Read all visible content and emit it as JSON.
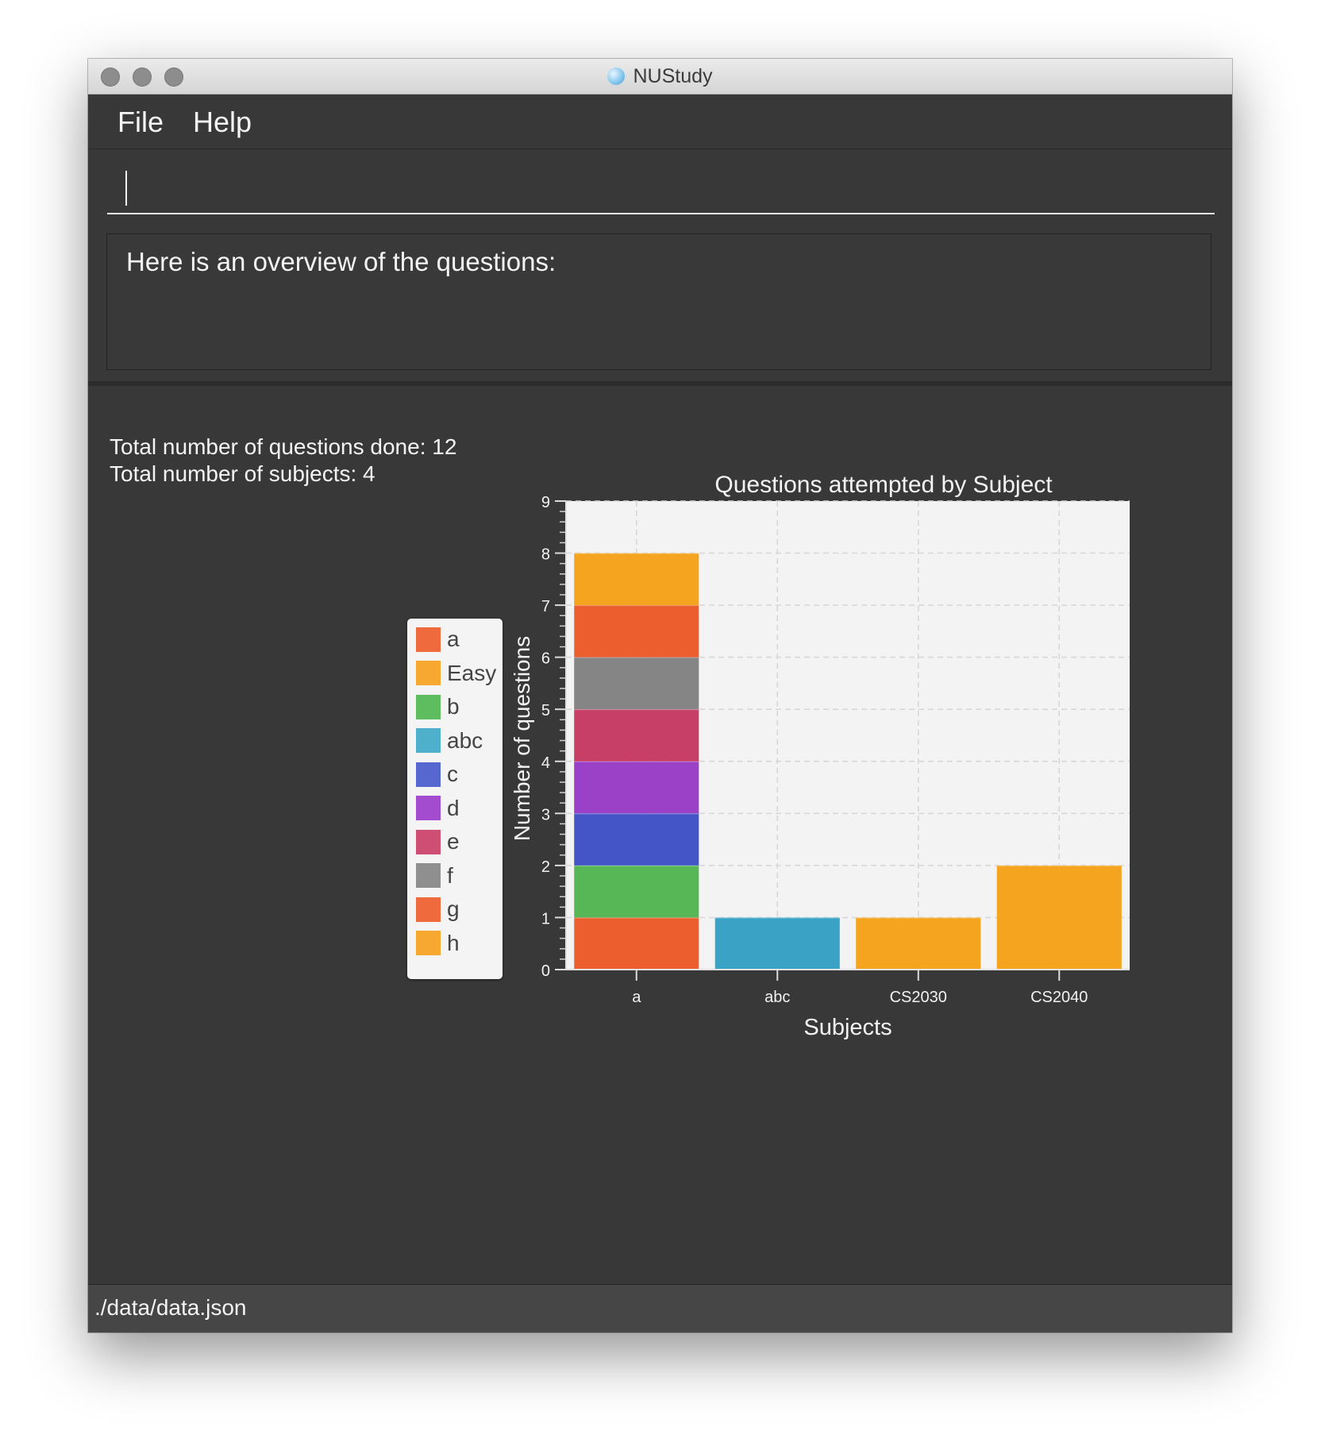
{
  "window": {
    "title": "NUStudy"
  },
  "menu": {
    "file": "File",
    "help": "Help"
  },
  "command": {
    "value": ""
  },
  "result": {
    "message": "Here is an overview of the questions:"
  },
  "stats": {
    "questions_done": "Total number of questions done: 12",
    "subjects": "Total number of subjects: 4"
  },
  "legend": [
    {
      "label": "a",
      "color": "#ef6a3c"
    },
    {
      "label": "Easy",
      "color": "#f6a830"
    },
    {
      "label": "b",
      "color": "#5ebd5e"
    },
    {
      "label": "abc",
      "color": "#4fb0cc"
    },
    {
      "label": "c",
      "color": "#5767d0"
    },
    {
      "label": "d",
      "color": "#a44ccf"
    },
    {
      "label": "e",
      "color": "#cf4f74"
    },
    {
      "label": "f",
      "color": "#8f8f8f"
    },
    {
      "label": "g",
      "color": "#ef6a3c"
    },
    {
      "label": "h",
      "color": "#f6a830"
    }
  ],
  "chart_data": {
    "type": "bar",
    "stacked": true,
    "title": "Questions attempted by Subject",
    "xlabel": "Subjects",
    "ylabel": "Number of questions",
    "ylim": [
      0,
      9
    ],
    "y_ticks": [
      "0",
      "1",
      "2",
      "3",
      "4",
      "5",
      "6",
      "7",
      "8",
      "9"
    ],
    "grid": true,
    "legend_position": "left",
    "categories": [
      "a",
      "abc",
      "CS2030",
      "CS2040"
    ],
    "series": [
      {
        "name": "a",
        "color": "#ec5e2d",
        "values": [
          1,
          0,
          0,
          0
        ]
      },
      {
        "name": "Easy",
        "color": "#f5a41f",
        "values": [
          0,
          0,
          1,
          2
        ]
      },
      {
        "name": "b",
        "color": "#57b757",
        "values": [
          1,
          0,
          0,
          0
        ]
      },
      {
        "name": "abc",
        "color": "#3aa3c5",
        "values": [
          0,
          1,
          0,
          0
        ]
      },
      {
        "name": "c",
        "color": "#4456c7",
        "values": [
          1,
          0,
          0,
          0
        ]
      },
      {
        "name": "d",
        "color": "#9b41c7",
        "values": [
          1,
          0,
          0,
          0
        ]
      },
      {
        "name": "e",
        "color": "#c73e66",
        "values": [
          1,
          0,
          0,
          0
        ]
      },
      {
        "name": "f",
        "color": "#858585",
        "values": [
          1,
          0,
          0,
          0
        ]
      },
      {
        "name": "g",
        "color": "#ec5e2d",
        "values": [
          1,
          0,
          0,
          0
        ]
      },
      {
        "name": "h",
        "color": "#f5a41f",
        "values": [
          1,
          0,
          0,
          0
        ]
      }
    ]
  },
  "status": {
    "path": "./data/data.json"
  }
}
